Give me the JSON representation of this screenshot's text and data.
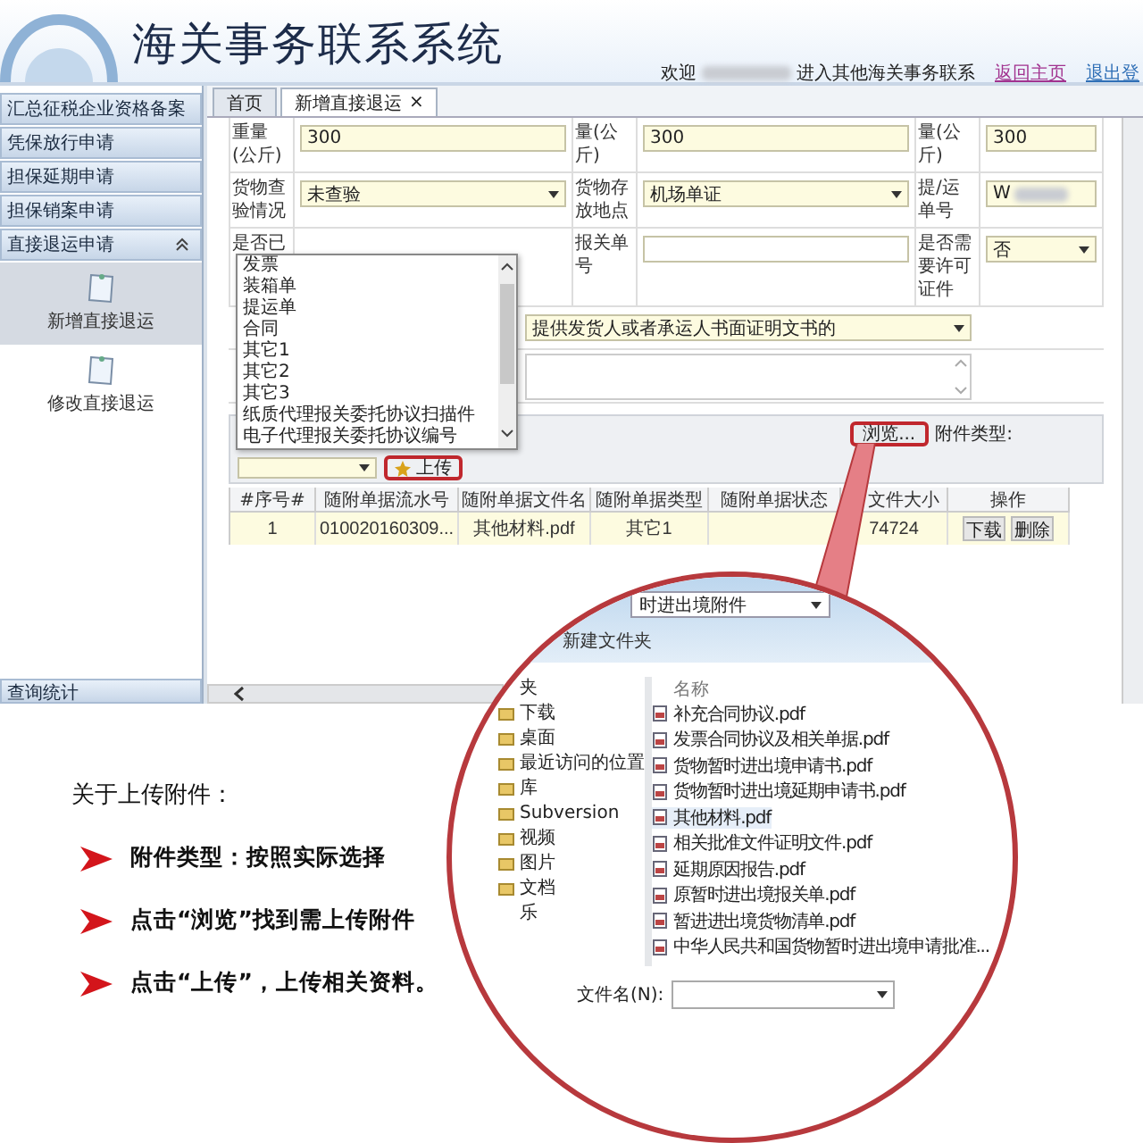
{
  "header": {
    "title": "海关事务联系系统",
    "welcome_prefix": "欢迎",
    "welcome_suffix": "进入其他海关事务联系",
    "links": [
      "返回主页",
      "退出登"
    ]
  },
  "sidebar": {
    "items": [
      {
        "label": "汇总征税企业资格备案",
        "expanded": false
      },
      {
        "label": "凭保放行申请",
        "expanded": false
      },
      {
        "label": "担保延期申请",
        "expanded": false
      },
      {
        "label": "担保销案申请",
        "expanded": false
      },
      {
        "label": "直接退运申请",
        "expanded": true,
        "children": [
          {
            "label": "新增直接退运",
            "selected": true
          },
          {
            "label": "修改直接退运",
            "selected": false
          }
        ]
      }
    ],
    "footer_item": "查询统计"
  },
  "tabs": [
    {
      "label": "首页",
      "selected": false
    },
    {
      "label": "新增直接退运",
      "selected": true,
      "close": "×"
    }
  ],
  "form": {
    "rows": [
      [
        {
          "kind": "label",
          "text": "重量(公斤)"
        },
        {
          "kind": "input",
          "value": "300"
        },
        {
          "kind": "label",
          "text": "量(公斤)"
        },
        {
          "kind": "input",
          "value": "300"
        },
        {
          "kind": "label",
          "text": "量(公斤)"
        },
        {
          "kind": "input",
          "value": "300"
        }
      ],
      [
        {
          "kind": "label",
          "text": "货物查验情况"
        },
        {
          "kind": "select",
          "value": "未查验"
        },
        {
          "kind": "label",
          "text": "货物存放地点"
        },
        {
          "kind": "select",
          "value": "机场单证"
        },
        {
          "kind": "label",
          "text": "提/运单号"
        },
        {
          "kind": "input",
          "value": "W",
          "blurred": true
        }
      ],
      [
        {
          "kind": "label",
          "text": "是否已"
        },
        {
          "kind": "empty"
        },
        {
          "kind": "label",
          "text": "报关单号"
        },
        {
          "kind": "input"
        },
        {
          "kind": "label",
          "text": "是否需要许可证件"
        },
        {
          "kind": "select",
          "value": "否"
        }
      ]
    ],
    "reason": "提供发货人或者承运人书面证明文书的"
  },
  "dropdown": {
    "options": [
      "发票",
      "装箱单",
      "提运单",
      "合同",
      "其它1",
      "其它2",
      "其它3",
      "纸质代理报关委托协议扫描件",
      "电子代理报关委托协议编号"
    ]
  },
  "upload": {
    "browse_button": "浏览...",
    "type_label": "附件类型:",
    "upload_button": "上传"
  },
  "table": {
    "columns": [
      "#序号#",
      "随附单据流水号",
      "随附单据文件名",
      "随附单据类型",
      "随附单据状态",
      "文件大小",
      "操作"
    ],
    "rows": [
      {
        "seq": "1",
        "serial": "010020160309...",
        "file": "其他材料.pdf",
        "type": "其它1",
        "size": "74724",
        "actions": [
          "下载",
          "删除"
        ]
      }
    ]
  },
  "instructions": {
    "title": "关于上传附件：",
    "bullets": [
      "附件类型：按照实际选择",
      "点击“浏览”找到需上传附件",
      "点击“上传”，上传相关资料。"
    ]
  },
  "magnifier": {
    "path": "时进出境附件",
    "new_folder": "新建文件夹",
    "nav": [
      {
        "label": "夹",
        "icon": false
      },
      {
        "label": "下载",
        "icon": true
      },
      {
        "label": "桌面",
        "icon": true
      },
      {
        "label": "最近访问的位置",
        "icon": true
      },
      {
        "label": "库",
        "icon": true
      },
      {
        "label": "Subversion",
        "icon": true
      },
      {
        "label": "视频",
        "icon": true
      },
      {
        "label": "图片",
        "icon": true
      },
      {
        "label": "文档",
        "icon": true
      },
      {
        "label": "乐",
        "icon": false
      }
    ],
    "name_header": "名称",
    "files": [
      {
        "name": "补充合同协议.pdf",
        "selected": false
      },
      {
        "name": "发票合同协议及相关单据.pdf",
        "selected": false
      },
      {
        "name": "货物暂时进出境申请书.pdf",
        "selected": false
      },
      {
        "name": "货物暂时进出境延期申请书.pdf",
        "selected": false
      },
      {
        "name": "其他材料.pdf",
        "selected": true
      },
      {
        "name": "相关批准文件证明文件.pdf",
        "selected": false
      },
      {
        "name": "延期原因报告.pdf",
        "selected": false
      },
      {
        "name": "原暂时进出境报关单.pdf",
        "selected": false
      },
      {
        "name": "暂进进出境货物清单.pdf",
        "selected": false
      },
      {
        "name": "中华人民共和国货物暂时进出境申请批准...",
        "selected": false
      }
    ],
    "filename_label": "文件名(N):"
  }
}
